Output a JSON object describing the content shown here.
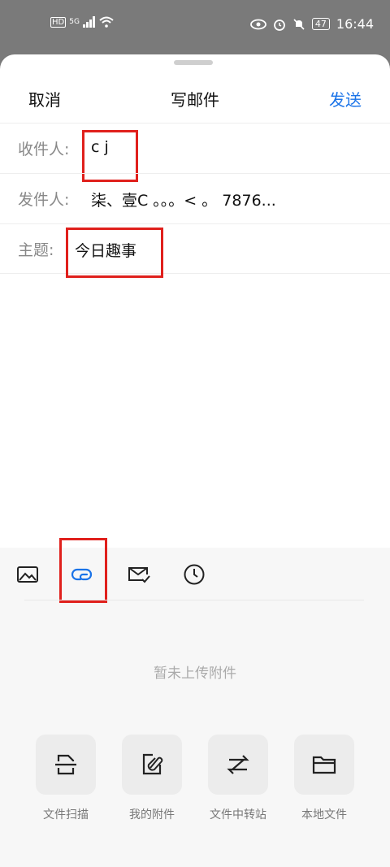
{
  "status_bar": {
    "hd": "HD",
    "signal": "5G",
    "battery": "47",
    "time": "16:44"
  },
  "header": {
    "cancel": "取消",
    "title": "写邮件",
    "send": "发送"
  },
  "fields": {
    "to_label": "收件人:",
    "to_value": "c  j",
    "from_label": "发件人:",
    "from_value": "柒、壹C     。。。<  。      7876...",
    "subject_label": "主题:",
    "subject_value": "今日趣事"
  },
  "attachments": {
    "empty_text": "暂未上传附件",
    "actions": [
      {
        "label": "文件扫描",
        "icon": "scan-document-icon"
      },
      {
        "label": "我的附件",
        "icon": "my-attachment-icon"
      },
      {
        "label": "文件中转站",
        "icon": "file-transfer-icon"
      },
      {
        "label": "本地文件",
        "icon": "folder-icon"
      }
    ]
  },
  "colors": {
    "accent": "#1a73e8",
    "highlight": "#e0201c"
  }
}
